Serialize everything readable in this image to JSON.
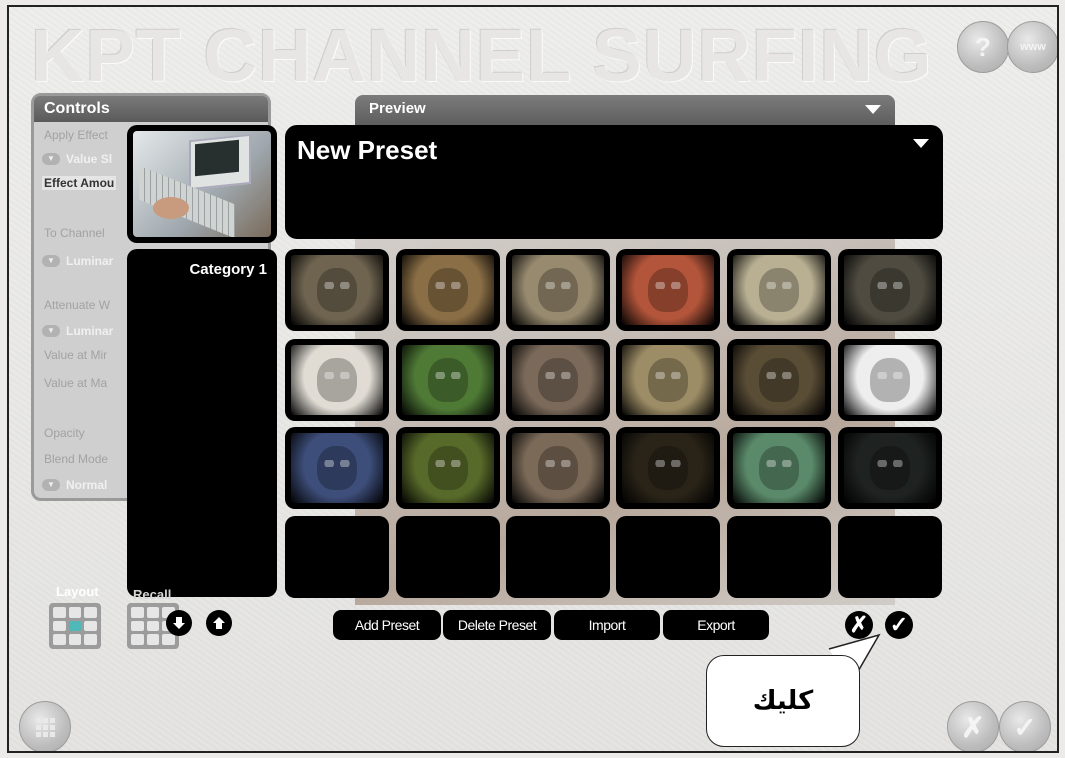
{
  "app": {
    "title": "KPT CHANNEL SURFING",
    "help_label": "?",
    "www_label": "www"
  },
  "controls_panel": {
    "header": "Controls",
    "apply_effect": "Apply Effect",
    "value_select": "Value Sl",
    "effect_amount": "Effect Amou",
    "to_channel": "To Channel",
    "luminance_1": "Luminar",
    "attenuate": "Attenuate W",
    "luminance_2": "Luminar",
    "value_min": "Value at Mir",
    "value_max": "Value at Ma",
    "opacity": "Opacity",
    "blend_mode": "Blend Mode",
    "blend_value": "Normal"
  },
  "preview_panel": {
    "header": "Preview"
  },
  "preset_dialog": {
    "preset_name": "New Preset",
    "categories": [
      "Category 1"
    ],
    "preset_swatches": [
      [
        "#6f6450",
        "#8a6e46",
        "#978a6f",
        "#b3553a",
        "#b9b093",
        "#4f4b40"
      ],
      [
        "#e0dcd4",
        "#4f7a36",
        "#7b6a5a",
        "#9d8d66",
        "#5a4d36",
        "#eeeeee"
      ],
      [
        "#3d4e7a",
        "#586a2a",
        "#7b6a58",
        "#2a2418",
        "#5a8a6a",
        "#1e2220"
      ],
      [
        "#000000",
        "#000000",
        "#000000",
        "#000000",
        "#000000",
        "#000000"
      ]
    ],
    "buttons": {
      "add_preset": "Add Preset",
      "delete_preset": "Delete Preset",
      "import": "Import",
      "export": "Export",
      "cancel": "✗",
      "ok": "✓"
    }
  },
  "bottom_bar": {
    "layout_label": "Layout",
    "recall_label": "Recall"
  },
  "callout": {
    "text": "كليك"
  }
}
